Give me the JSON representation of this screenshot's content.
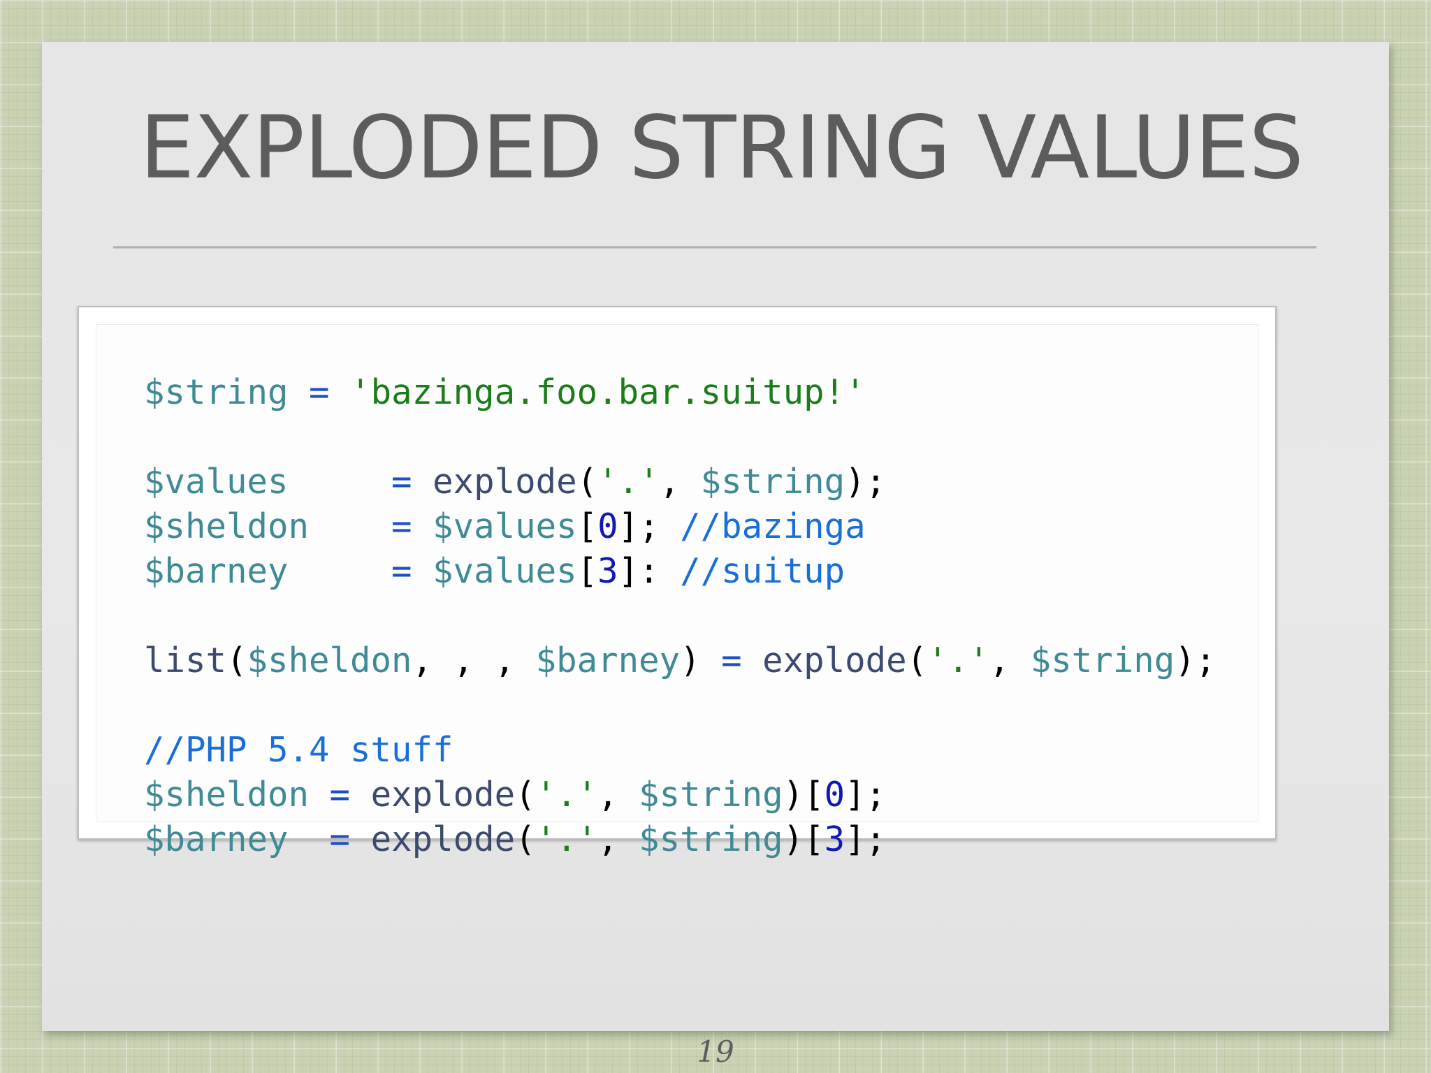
{
  "slide": {
    "title": "EXPLODED STRING VALUES",
    "page_number": "19"
  },
  "code": {
    "language": "php",
    "lines": [
      "$string = 'bazinga.foo.bar.suitup!'",
      "",
      "$values     = explode('.', $string);",
      "$sheldon    = $values[0]; //bazinga",
      "$barney     = $values[3]: //suitup",
      "",
      "list($sheldon, , , $barney) = explode('.', $string);",
      "",
      "//PHP 5.4 stuff",
      "$sheldon = explode('.', $string)[0];",
      "$barney  = explode('.', $string)[3];"
    ],
    "tokens": [
      [
        {
          "t": "$string",
          "c": "var"
        },
        {
          "t": " ",
          "c": "punc"
        },
        {
          "t": "=",
          "c": "op"
        },
        {
          "t": " ",
          "c": "punc"
        },
        {
          "t": "'bazinga.foo.bar.suitup!'",
          "c": "str"
        }
      ],
      [],
      [
        {
          "t": "$values",
          "c": "var"
        },
        {
          "t": "     ",
          "c": "punc"
        },
        {
          "t": "=",
          "c": "op"
        },
        {
          "t": " ",
          "c": "punc"
        },
        {
          "t": "explode",
          "c": "fn"
        },
        {
          "t": "(",
          "c": "punc"
        },
        {
          "t": "'.'",
          "c": "str"
        },
        {
          "t": ", ",
          "c": "punc"
        },
        {
          "t": "$string",
          "c": "var"
        },
        {
          "t": ");",
          "c": "punc"
        }
      ],
      [
        {
          "t": "$sheldon",
          "c": "var"
        },
        {
          "t": "    ",
          "c": "punc"
        },
        {
          "t": "=",
          "c": "op"
        },
        {
          "t": " ",
          "c": "punc"
        },
        {
          "t": "$values",
          "c": "var"
        },
        {
          "t": "[",
          "c": "punc"
        },
        {
          "t": "0",
          "c": "num"
        },
        {
          "t": "]; ",
          "c": "punc"
        },
        {
          "t": "//bazinga",
          "c": "cmt"
        }
      ],
      [
        {
          "t": "$barney",
          "c": "var"
        },
        {
          "t": "     ",
          "c": "punc"
        },
        {
          "t": "=",
          "c": "op"
        },
        {
          "t": " ",
          "c": "punc"
        },
        {
          "t": "$values",
          "c": "var"
        },
        {
          "t": "[",
          "c": "punc"
        },
        {
          "t": "3",
          "c": "num"
        },
        {
          "t": "]: ",
          "c": "punc"
        },
        {
          "t": "//suitup",
          "c": "cmt"
        }
      ],
      [],
      [
        {
          "t": "list",
          "c": "fn"
        },
        {
          "t": "(",
          "c": "punc"
        },
        {
          "t": "$sheldon",
          "c": "var"
        },
        {
          "t": ", , , ",
          "c": "punc"
        },
        {
          "t": "$barney",
          "c": "var"
        },
        {
          "t": ") ",
          "c": "punc"
        },
        {
          "t": "=",
          "c": "op"
        },
        {
          "t": " ",
          "c": "punc"
        },
        {
          "t": "explode",
          "c": "fn"
        },
        {
          "t": "(",
          "c": "punc"
        },
        {
          "t": "'.'",
          "c": "str"
        },
        {
          "t": ", ",
          "c": "punc"
        },
        {
          "t": "$string",
          "c": "var"
        },
        {
          "t": ");",
          "c": "punc"
        }
      ],
      [],
      [
        {
          "t": "//PHP 5.4 stuff",
          "c": "cmt"
        }
      ],
      [
        {
          "t": "$sheldon",
          "c": "var"
        },
        {
          "t": " ",
          "c": "punc"
        },
        {
          "t": "=",
          "c": "op"
        },
        {
          "t": " ",
          "c": "punc"
        },
        {
          "t": "explode",
          "c": "fn"
        },
        {
          "t": "(",
          "c": "punc"
        },
        {
          "t": "'.'",
          "c": "str"
        },
        {
          "t": ", ",
          "c": "punc"
        },
        {
          "t": "$string",
          "c": "var"
        },
        {
          "t": ")[",
          "c": "punc"
        },
        {
          "t": "0",
          "c": "num"
        },
        {
          "t": "];",
          "c": "punc"
        }
      ],
      [
        {
          "t": "$barney",
          "c": "var"
        },
        {
          "t": "  ",
          "c": "punc"
        },
        {
          "t": "=",
          "c": "op"
        },
        {
          "t": " ",
          "c": "punc"
        },
        {
          "t": "explode",
          "c": "fn"
        },
        {
          "t": "(",
          "c": "punc"
        },
        {
          "t": "'.'",
          "c": "str"
        },
        {
          "t": ", ",
          "c": "punc"
        },
        {
          "t": "$string",
          "c": "var"
        },
        {
          "t": ")[",
          "c": "punc"
        },
        {
          "t": "3",
          "c": "num"
        },
        {
          "t": "];",
          "c": "punc"
        }
      ]
    ]
  },
  "colors": {
    "page_background": "#c9d3b3",
    "slide_background": "#e6e6e6",
    "title_text": "#5c5c5c",
    "variable": "#3f8a95",
    "operator": "#1d4fc4",
    "string": "#1a7d1a",
    "function": "#3c4a6e",
    "number": "#1118b3",
    "comment": "#1a6fd6",
    "punctuation": "#000000"
  }
}
